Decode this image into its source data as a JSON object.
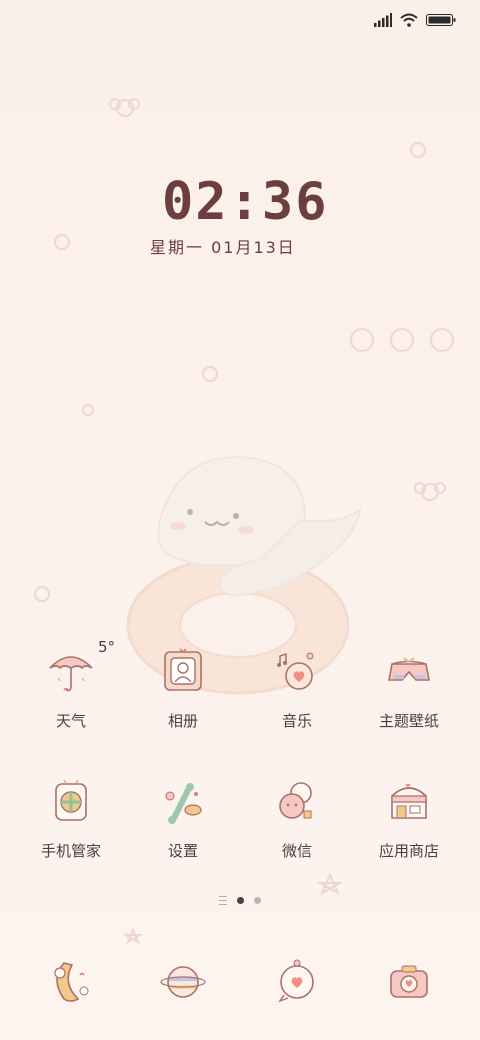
{
  "status_bar": {
    "signal": "signal-icon",
    "wifi": "wifi-icon",
    "battery": "battery-icon"
  },
  "clock": {
    "time": "02:36",
    "date": "星期一  01月13日"
  },
  "weather_widget": {
    "temperature": "5°"
  },
  "apps_row1": [
    {
      "label": "天气",
      "icon": "umbrella-icon"
    },
    {
      "label": "相册",
      "icon": "photo-frame-icon"
    },
    {
      "label": "音乐",
      "icon": "music-heart-icon"
    },
    {
      "label": "主题壁纸",
      "icon": "shorts-icon"
    }
  ],
  "apps_row2": [
    {
      "label": "手机管家",
      "icon": "shield-jar-icon"
    },
    {
      "label": "设置",
      "icon": "bone-gear-icon"
    },
    {
      "label": "微信",
      "icon": "chat-bubbles-icon"
    },
    {
      "label": "应用商店",
      "icon": "shop-icon"
    }
  ],
  "page_indicator": {
    "pages": 2,
    "active": 1
  },
  "dock": [
    {
      "icon": "phone-moon-icon"
    },
    {
      "icon": "planet-icon"
    },
    {
      "icon": "heart-bubble-icon"
    },
    {
      "icon": "camera-icon"
    }
  ],
  "colors": {
    "text": "#4a3f3d",
    "clock": "#6b3f3b",
    "background": "#fbefe9",
    "accent_pink": "#f2a7a0"
  }
}
